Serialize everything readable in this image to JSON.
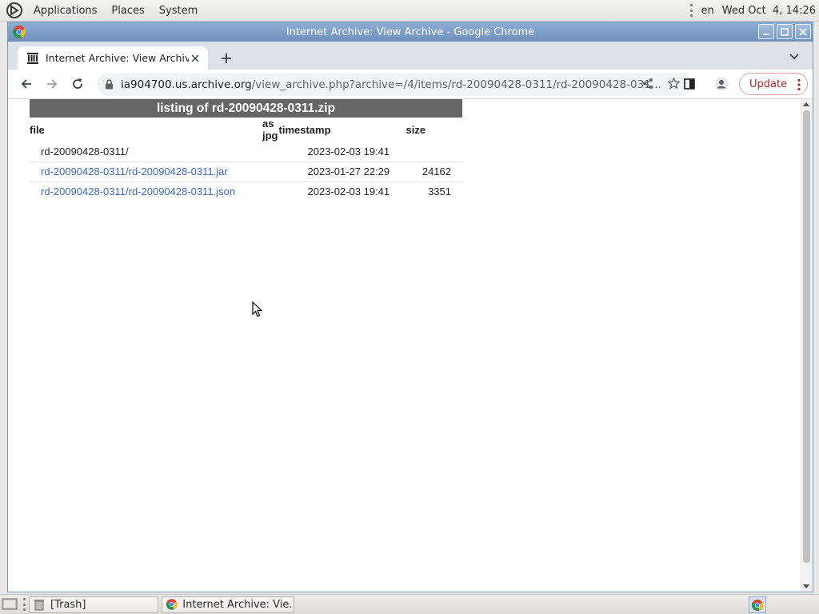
{
  "top_panel": {
    "menus": [
      "Applications",
      "Places",
      "System"
    ],
    "keyboard_layout": "en",
    "clock": "Wed Oct  4, 14:26"
  },
  "window": {
    "title": "Internet Archive: View Archive - Google Chrome"
  },
  "tab": {
    "title": "Internet Archive: View Archive"
  },
  "toolbar": {
    "url_host": "ia904700.us.archive.org",
    "url_path": "/view_archive.php?archive=/4/items/rd-20090428-0311/rd-20090428-031...",
    "update_label": "Update"
  },
  "listing": {
    "caption": "listing of rd-20090428-0311.zip",
    "headers": {
      "file": "file",
      "as_jpg": "as jpg",
      "timestamp": "timestamp",
      "size": "size"
    },
    "rows": [
      {
        "file": "rd-20090428-0311/",
        "timestamp": "2023-02-03 19:41",
        "size": ""
      },
      {
        "file": "rd-20090428-0311/rd-20090428-0311.jar",
        "timestamp": "2023-01-27 22:29",
        "size": "24162"
      },
      {
        "file": "rd-20090428-0311/rd-20090428-0311.json",
        "timestamp": "2023-02-03 19:41",
        "size": "3351"
      }
    ]
  },
  "taskbar": {
    "items": [
      "[Trash]",
      "Internet Archive: Vie..."
    ]
  },
  "colors": {
    "link": "#3d66c8",
    "caption_bg": "#666666",
    "update_text": "#b3261e",
    "titlebar": "#7d9dc7"
  }
}
